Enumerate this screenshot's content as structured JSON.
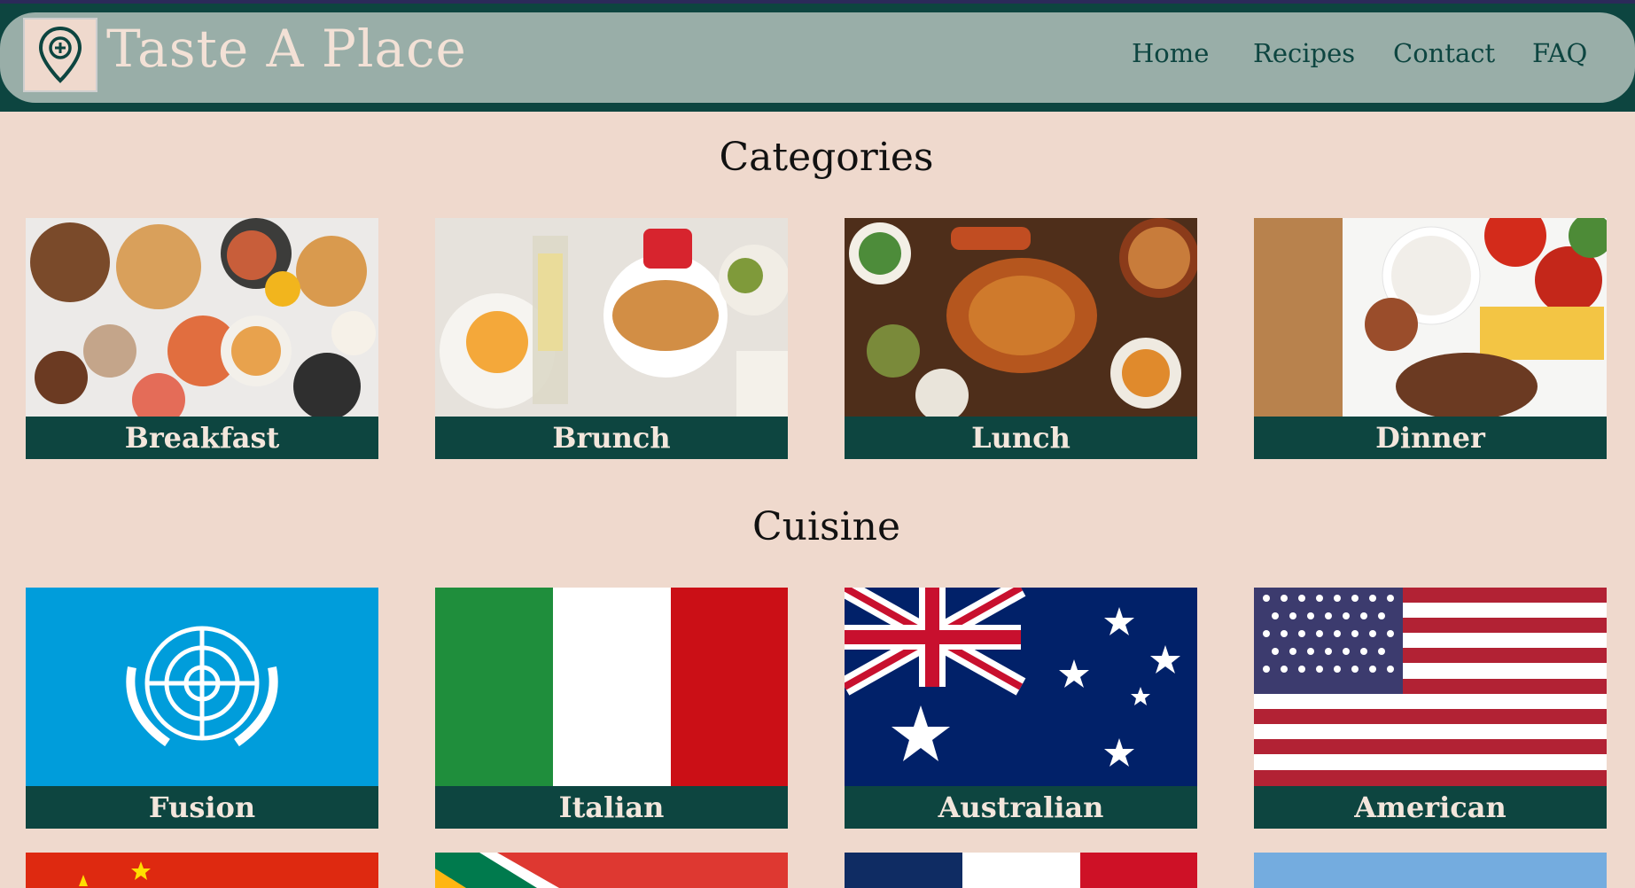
{
  "header": {
    "brand": "Taste A Place",
    "nav": [
      "Home",
      "Recipes",
      "Contact",
      "FAQ"
    ]
  },
  "sections": {
    "categories_title": "Categories",
    "cuisine_title": "Cuisine"
  },
  "categories": [
    "Breakfast",
    "Brunch",
    "Lunch",
    "Dinner"
  ],
  "cuisines": [
    "Fusion",
    "Italian",
    "Australian",
    "American"
  ],
  "colors": {
    "page_bg": "#efd9cd",
    "navbar": "#99aea8",
    "dark_teal": "#0d4540",
    "label_text": "#f3e6dc"
  },
  "icons": {
    "logo": "map-pin-plus-icon"
  }
}
